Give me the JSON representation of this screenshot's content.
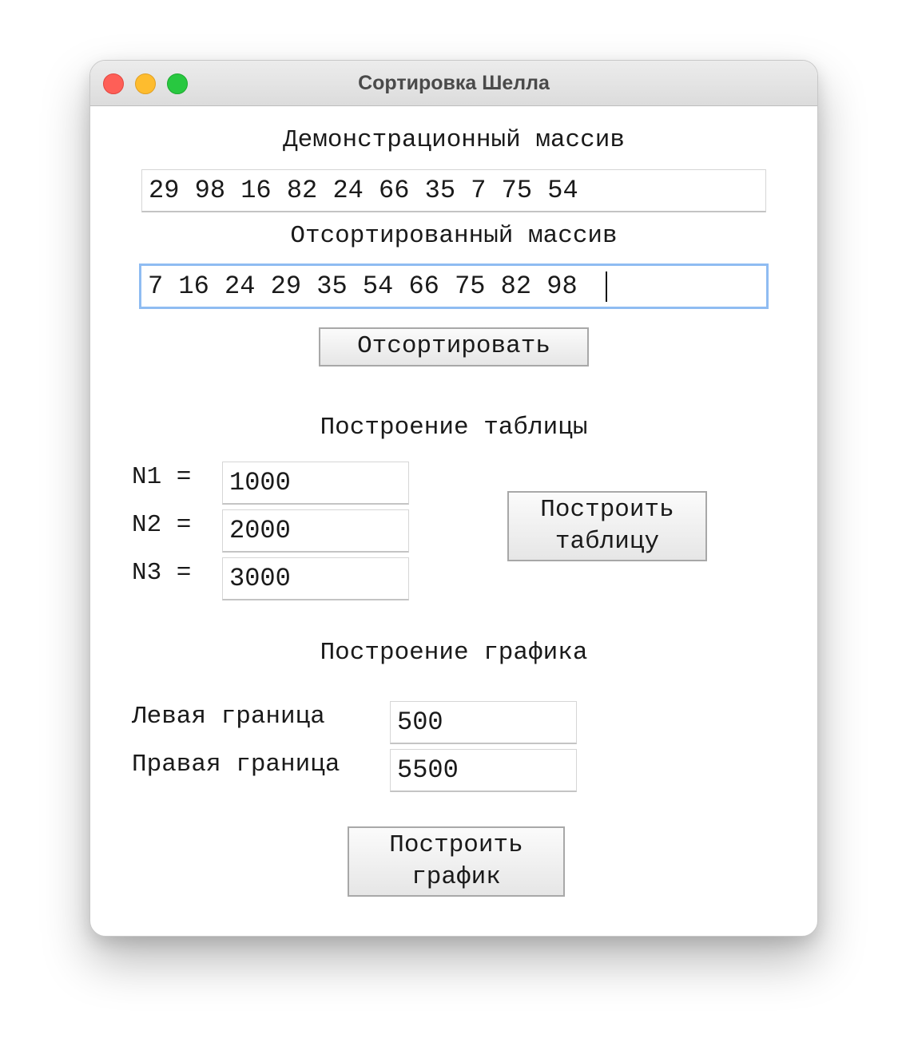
{
  "window": {
    "title": "Сортировка Шелла"
  },
  "demo": {
    "label": "Демонстрационный массив",
    "value": "29 98 16 82 24 66 35 7 75 54"
  },
  "sorted": {
    "label": "Отсортированный массив",
    "value": "7 16 24 29 35 54 66 75 82 98 "
  },
  "sort_button": "Отсортировать",
  "table": {
    "header": "Построение таблицы",
    "n1_label": "N1 =",
    "n1_value": "1000",
    "n2_label": "N2 =",
    "n2_value": "2000",
    "n3_label": "N3 =",
    "n3_value": "3000",
    "build_button": "Построить\nтаблицу"
  },
  "chart": {
    "header": "Построение графика",
    "left_label": "Левая граница",
    "left_value": "500",
    "right_label": "Правая граница",
    "right_value": "5500",
    "build_button": "Построить\nграфик"
  },
  "colors": {
    "focus_ring": "#8fbcf2",
    "close": "#fe5f57",
    "minimize": "#febc2e",
    "zoom": "#28c840"
  }
}
